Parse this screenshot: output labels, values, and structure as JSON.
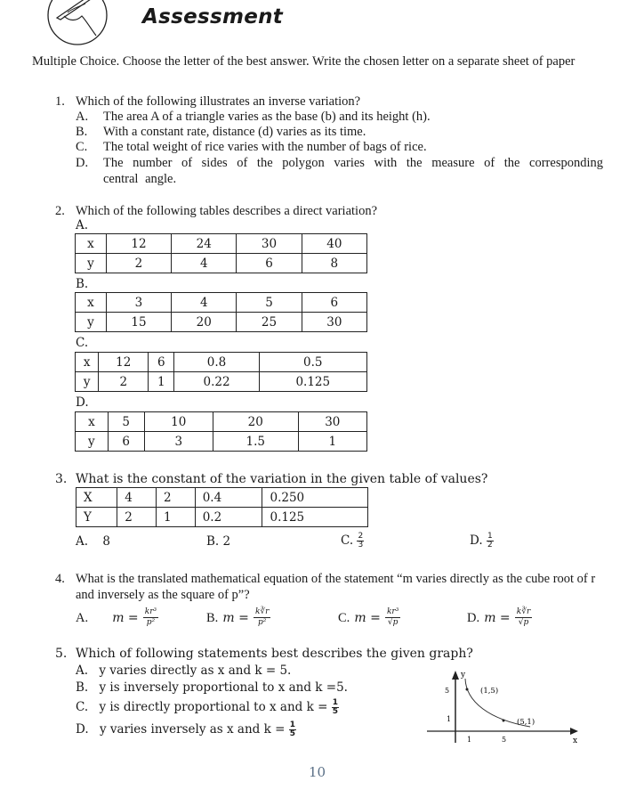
{
  "header": {
    "icon": "hand-writing-icon",
    "title": "Assessment"
  },
  "instructions": "Multiple Choice. Choose the letter of the best answer. Write the chosen letter on a separate sheet of paper",
  "questions": [
    {
      "number": "1.",
      "text": "Which of the following illustrates an inverse variation?",
      "options": [
        {
          "letter": "A.",
          "text": "The area A of a triangle varies as the base (b) and its height (h)."
        },
        {
          "letter": "B.",
          "text": "With a constant rate, distance (d) varies as its time."
        },
        {
          "letter": "C.",
          "text": "The total weight of rice varies with the number of bags of rice."
        },
        {
          "letter": "D.",
          "text": "The number of sides of the polygon varies with the measure of the corresponding central angle."
        }
      ]
    },
    {
      "number": "2.",
      "text": "Which of the following tables describes a direct variation?",
      "tables": [
        {
          "letter": "A.",
          "x": [
            "x",
            "12",
            "24",
            "30",
            "40"
          ],
          "y": [
            "y",
            "2",
            "4",
            "6",
            "8"
          ]
        },
        {
          "letter": "B.",
          "x": [
            "x",
            "3",
            "4",
            "5",
            "6"
          ],
          "y": [
            "y",
            "15",
            "20",
            "25",
            "30"
          ]
        },
        {
          "letter": "C.",
          "x": [
            "x",
            "12",
            "6",
            "0.8",
            "0.5"
          ],
          "y": [
            "y",
            "2",
            "1",
            "0.22",
            "0.125"
          ]
        },
        {
          "letter": "D.",
          "x": [
            "x",
            "5",
            "10",
            "20",
            "30"
          ],
          "y": [
            "y",
            "6",
            "3",
            "1.5",
            "1"
          ]
        }
      ]
    },
    {
      "number": "3.",
      "text": "What is the constant of the variation in the given table of values?",
      "table": {
        "x": [
          "X",
          "4",
          "2",
          "0.4",
          "0.250"
        ],
        "y": [
          "Y",
          "2",
          "1",
          "0.2",
          "0.125"
        ]
      },
      "options": [
        {
          "letter": "A.",
          "text": "8"
        },
        {
          "letter": "B.",
          "text": "2"
        },
        {
          "letter": "C.",
          "num": "2",
          "den": "3"
        },
        {
          "letter": "D.",
          "num": "1",
          "den": "2"
        }
      ]
    },
    {
      "number": "4.",
      "text": "What is the translated mathematical equation of the statement “m varies directly as the cube root of r and inversely as the square of p”?",
      "options": [
        {
          "letter": "A.",
          "lhs": "m =",
          "num": "kr³",
          "den": "p²"
        },
        {
          "letter": "B.",
          "lhs": "m =",
          "num": "k∛r",
          "den": "p²"
        },
        {
          "letter": "C.",
          "lhs": "m =",
          "num": "kr³",
          "den": "√p"
        },
        {
          "letter": "D.",
          "lhs": "m =",
          "num": "k∛r",
          "den": "√p"
        }
      ]
    },
    {
      "number": "5.",
      "text": "Which of following statements best describes the given graph?",
      "options": [
        {
          "letter": "A.",
          "text": "y varies directly as x and k = 5."
        },
        {
          "letter": "B.",
          "text": "y is inversely proportional to x and k =5."
        },
        {
          "letter": "C.",
          "text": "y is directly proportional to x and k =",
          "num": "1",
          "den": "5"
        },
        {
          "letter": "D.",
          "text": "y varies inversely as x and k =",
          "num": "1",
          "den": "5"
        }
      ],
      "graph": {
        "y_axis_label": "y",
        "x_axis_label": "x",
        "y_ticks": [
          "5",
          "1"
        ],
        "x_ticks": [
          "1",
          "5"
        ],
        "points": [
          {
            "label": "(1,5)",
            "x": 1,
            "y": 5
          },
          {
            "label": "(5,1)",
            "x": 5,
            "y": 1
          }
        ]
      }
    }
  ],
  "page_number": "10"
}
